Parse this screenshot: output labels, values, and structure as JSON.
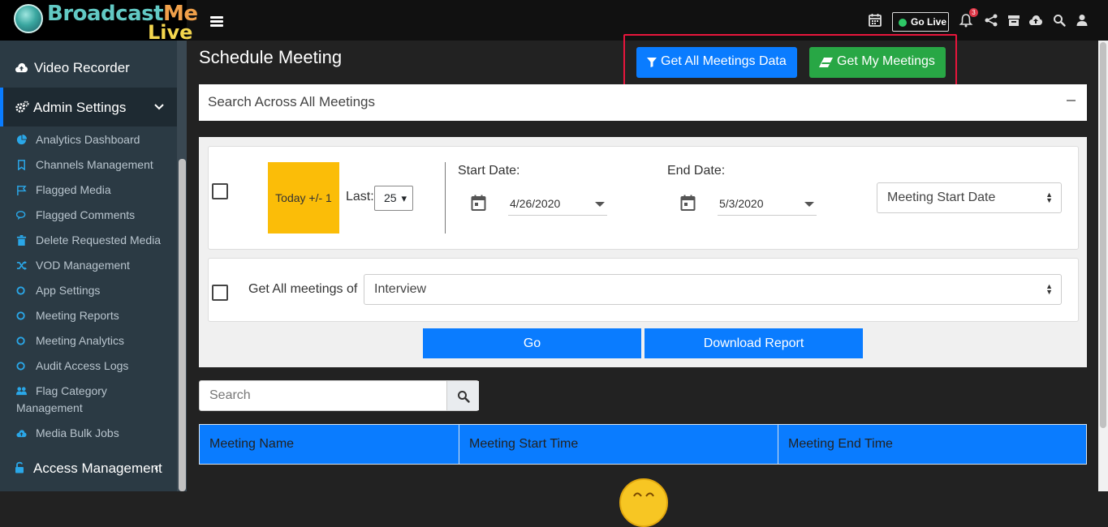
{
  "header": {
    "logo_text_1": "Broadcast",
    "logo_text_1b": "Me",
    "logo_text_2": "Live",
    "go_live_label": "Go Live",
    "notification_count": "3"
  },
  "sidebar": {
    "video_recorder": "Video Recorder",
    "admin_settings": "Admin Settings",
    "items": [
      {
        "label": "Analytics Dashboard",
        "icon": "pie-chart-icon"
      },
      {
        "label": "Channels Management",
        "icon": "bookmark-icon"
      },
      {
        "label": "Flagged Media",
        "icon": "flag-icon"
      },
      {
        "label": "Flagged Comments",
        "icon": "comments-icon"
      },
      {
        "label": "Delete Requested Media",
        "icon": "trash-icon"
      },
      {
        "label": "VOD Management",
        "icon": "shuffle-icon"
      },
      {
        "label": "App Settings",
        "icon": "circle-icon"
      },
      {
        "label": "Meeting Reports",
        "icon": "circle-icon"
      },
      {
        "label": "Meeting Analytics",
        "icon": "circle-icon"
      },
      {
        "label": "Audit Access Logs",
        "icon": "circle-icon"
      },
      {
        "label": "Flag Category",
        "label2": "Management",
        "icon": "users-icon"
      },
      {
        "label": "Media Bulk Jobs",
        "icon": "cloud-upload-icon"
      }
    ],
    "access_management": "Access Management"
  },
  "main": {
    "title": "Schedule Meeting",
    "get_all_label": "Get All Meetings Data",
    "get_my_label": "Get My Meetings",
    "search_across": "Search Across All Meetings",
    "today_label": "Today +/- 1",
    "last_label": "Last:",
    "last_value": "25",
    "start_date_label": "Start Date:",
    "start_date_value": "4/26/2020",
    "end_date_label": "End Date:",
    "end_date_value": "5/3/2020",
    "sort_select": "Meeting Start Date",
    "get_all_of_label": "Get All meetings of",
    "meeting_type_select": "Interview",
    "go_label": "Go",
    "download_label": "Download Report",
    "search_placeholder": "Search",
    "columns": [
      "Meeting Name",
      "Meeting Start Time",
      "Meeting End Time"
    ]
  },
  "colors": {
    "primary_blue": "#0a7cff",
    "success_green": "#28a745",
    "today_yellow": "#fbbd08",
    "highlight_red": "#e8153c"
  }
}
